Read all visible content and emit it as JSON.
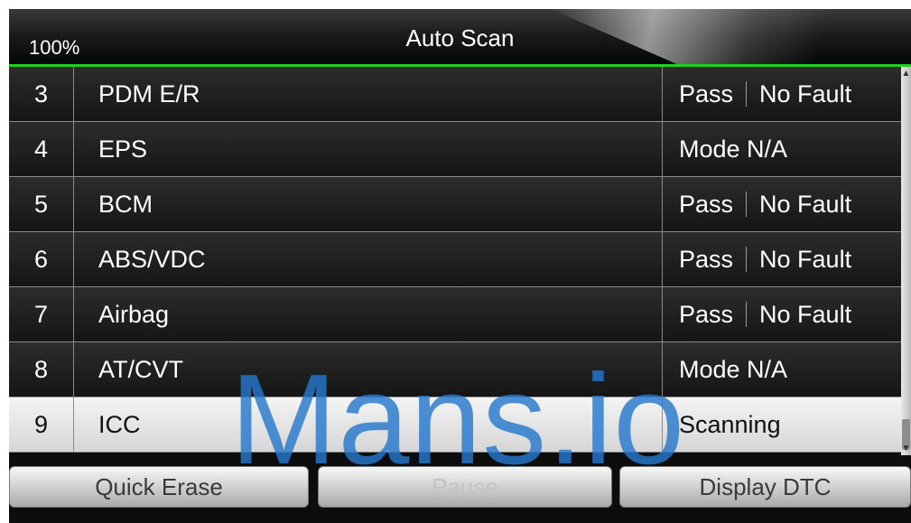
{
  "header": {
    "battery": "100%",
    "title": "Auto Scan"
  },
  "rows": [
    {
      "num": "3",
      "name": "PDM E/R",
      "status": "Pass",
      "detail": "No Fault"
    },
    {
      "num": "4",
      "name": "EPS",
      "status": "Mode N/A",
      "detail": ""
    },
    {
      "num": "5",
      "name": "BCM",
      "status": "Pass",
      "detail": "No Fault"
    },
    {
      "num": "6",
      "name": "ABS/VDC",
      "status": "Pass",
      "detail": "No Fault"
    },
    {
      "num": "7",
      "name": "Airbag",
      "status": "Pass",
      "detail": "No Fault"
    },
    {
      "num": "8",
      "name": "AT/CVT",
      "status": "Mode N/A",
      "detail": ""
    },
    {
      "num": "9",
      "name": "ICC",
      "status": "Scanning",
      "detail": ""
    }
  ],
  "selected_row_index": 6,
  "buttons": {
    "quick_erase": "Quick Erase",
    "pause": "Pause",
    "display_dtc": "Display DTC"
  },
  "watermark": "Mans.io",
  "colors": {
    "accent_line": "#1fd01f",
    "watermark": "#2678cd"
  }
}
